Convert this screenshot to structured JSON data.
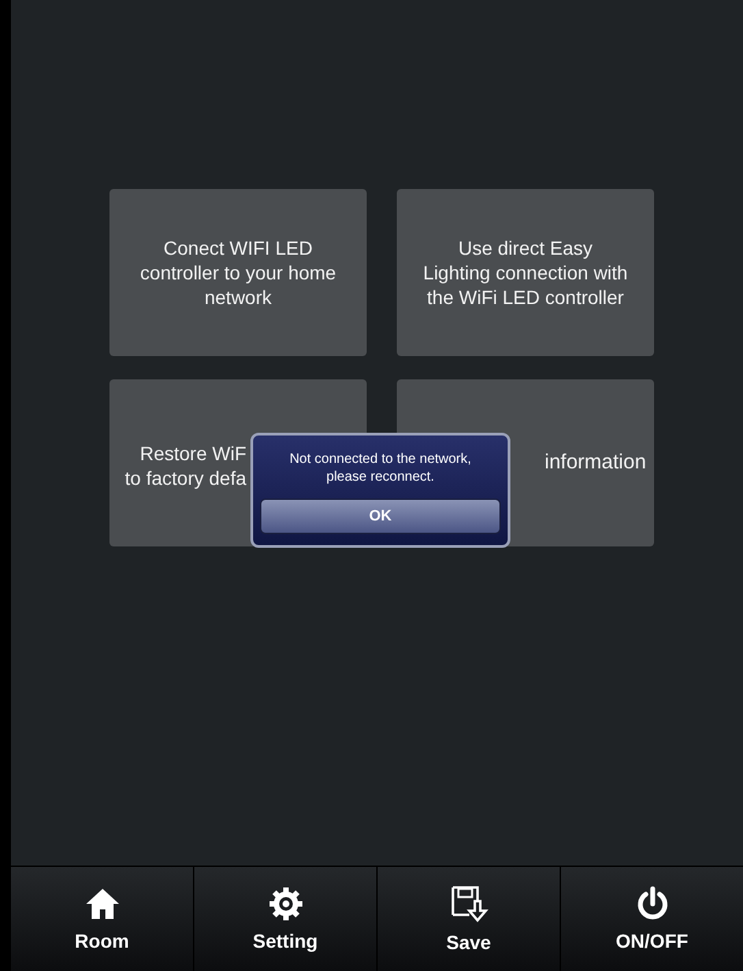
{
  "tiles": [
    {
      "lines": [
        "Conect WIFI LED",
        "controller to your home",
        "network"
      ]
    },
    {
      "lines": [
        "Use direct Easy",
        "Lighting connection with",
        "the WiFi LED controller"
      ]
    },
    {
      "lines": [
        "Restore WiF",
        "to factory defa"
      ]
    },
    {
      "lines": [
        "information"
      ]
    }
  ],
  "dialog": {
    "message": [
      "Not connected to the network,",
      "please reconnect."
    ],
    "button": "OK"
  },
  "tabbar": [
    {
      "label": "Room",
      "kind": "home"
    },
    {
      "label": "Setting",
      "kind": "settings"
    },
    {
      "label": "Save",
      "kind": "save"
    },
    {
      "label": "ON/OFF",
      "kind": "power"
    }
  ]
}
